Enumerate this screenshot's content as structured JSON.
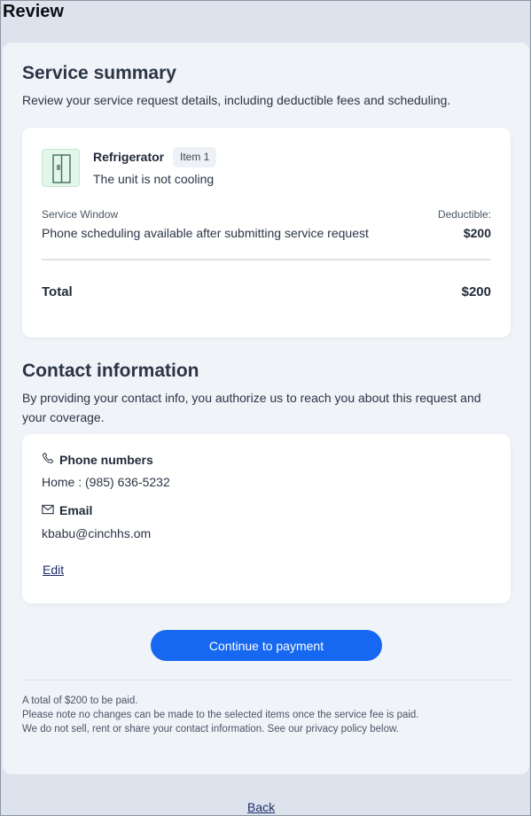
{
  "header": {
    "title": "Review"
  },
  "summary": {
    "title": "Service summary",
    "description": "Review your service request details, including deductible fees and scheduling.",
    "item": {
      "name": "Refrigerator",
      "badge": "Item 1",
      "issue": "The unit is not cooling",
      "icon": "refrigerator-icon"
    },
    "service_window_label": "Service Window",
    "service_window_value": "Phone scheduling available after submitting service request",
    "deductible_label": "Deductible:",
    "deductible_amount": "$200",
    "total_label": "Total",
    "total_amount": "$200"
  },
  "contact": {
    "title": "Contact information",
    "description": "By providing your contact info, you authorize us to reach you about this request and your coverage.",
    "phone_heading": "Phone numbers",
    "phone_value": "Home : (985) 636-5232",
    "email_heading": "Email",
    "email_value": "kbabu@cinchhs.om",
    "edit_label": "Edit"
  },
  "actions": {
    "continue_label": "Continue to payment",
    "back_label": "Back"
  },
  "notes": [
    "A total of $200 to be paid.",
    "Please note no changes can be made to the selected items once the service fee is paid.",
    "We do not sell, rent or share your contact information. See our privacy policy below."
  ],
  "colors": {
    "accent": "#1668f0",
    "link": "#1f2d6b",
    "page_background": "#dde3ec",
    "panel_background": "#f0f3f8"
  }
}
